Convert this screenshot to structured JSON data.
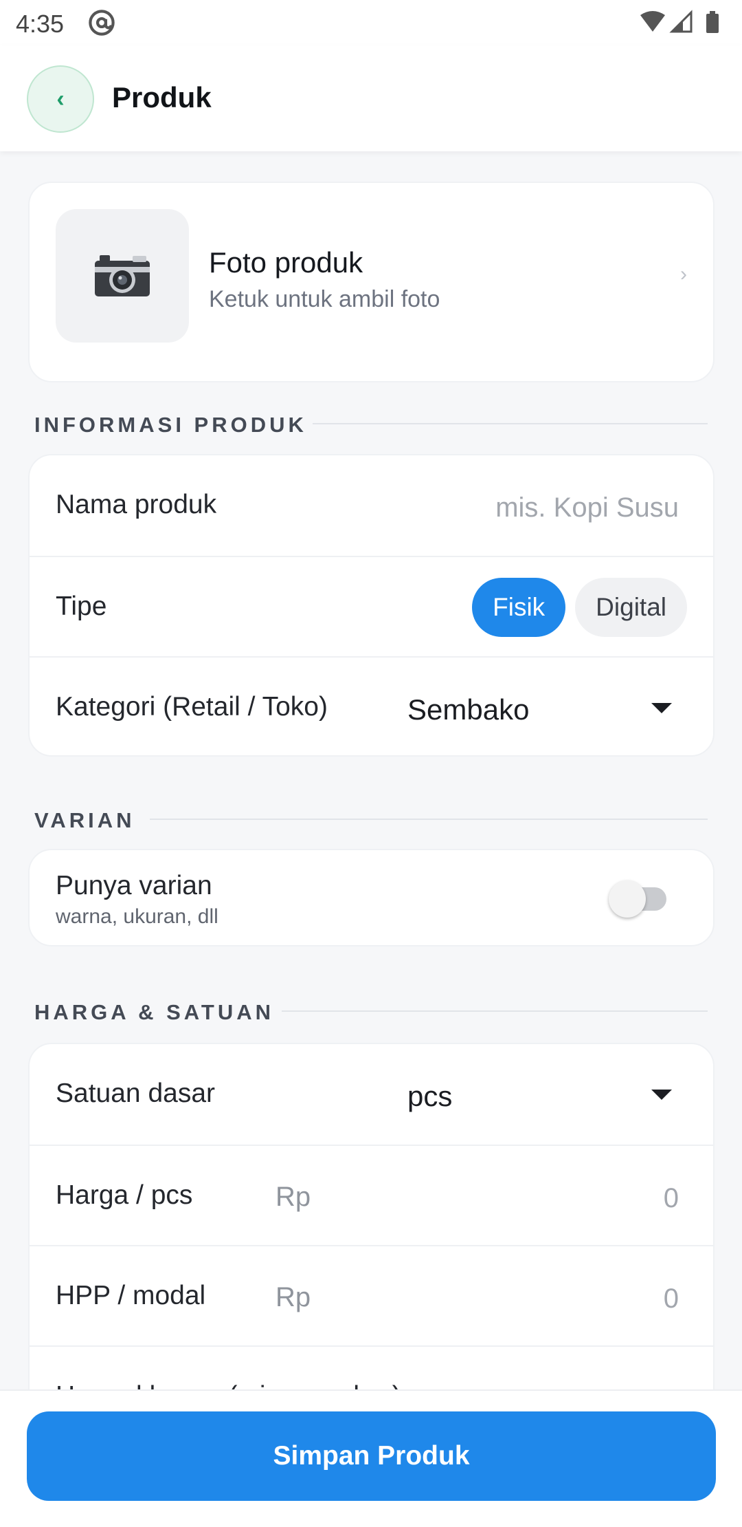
{
  "status_bar": {
    "time": "4:35"
  },
  "app_bar": {
    "back_glyph": "‹",
    "title": "Produk"
  },
  "photo": {
    "title": "Foto produk",
    "subtitle": "Ketuk untuk ambil foto",
    "chevron": "›"
  },
  "sections": {
    "info": "INFORMASI PRODUK",
    "varian": "VARIAN",
    "harga": "HARGA & SATUAN"
  },
  "info": {
    "name_label": "Nama produk",
    "name_placeholder": "mis. Kopi Susu",
    "type_label": "Tipe",
    "type_options": [
      "Fisik",
      "Digital"
    ],
    "type_selected": "Fisik",
    "category_label": "Kategori (Retail / Toko)",
    "category_value": "Sembako"
  },
  "varian": {
    "label": "Punya varian",
    "sub": "warna, ukuran, dll",
    "enabled": false
  },
  "harga": {
    "unit_label": "Satuan dasar",
    "unit_value": "pcs",
    "price_label": "Harga / pcs",
    "price_prefix": "Rp",
    "price_value": "0",
    "cost_label": "HPP / modal",
    "cost_prefix": "Rp",
    "cost_value": "0",
    "special_label": "Harga khusus (mis. member)"
  },
  "footer": {
    "save_label": "Simpan Produk"
  },
  "colors": {
    "primary": "#1f88ea",
    "back_accent": "#1f9d6a",
    "background": "#f6f7f9"
  },
  "icons": [
    "at-sign-icon",
    "wifi-icon",
    "signal-icon",
    "battery-icon",
    "back-icon",
    "camera-icon",
    "chevron-right-icon",
    "dropdown-caret-icon"
  ]
}
